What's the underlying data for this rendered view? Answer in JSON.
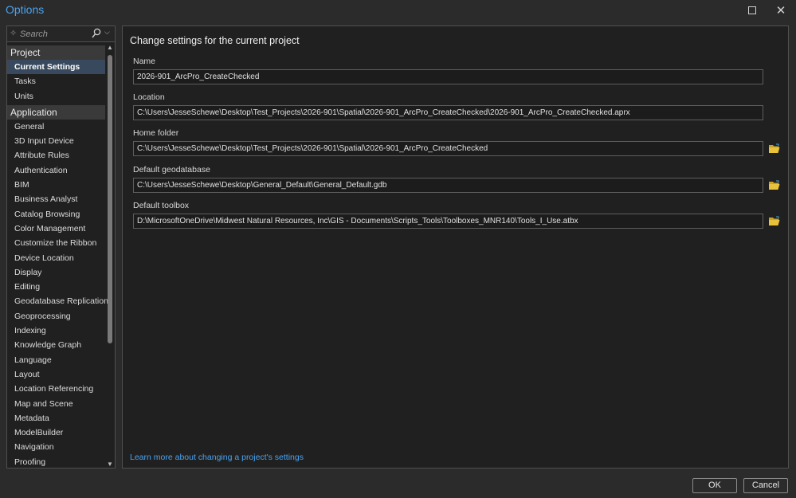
{
  "window": {
    "title": "Options"
  },
  "search": {
    "placeholder": "Search"
  },
  "nav": {
    "project_group": "Project",
    "project_items": [
      "Current Settings",
      "Tasks",
      "Units"
    ],
    "application_group": "Application",
    "application_items": [
      "General",
      "3D Input Device",
      "Attribute Rules",
      "Authentication",
      "BIM",
      "Business Analyst",
      "Catalog Browsing",
      "Color Management",
      "Customize the Ribbon",
      "Device Location",
      "Display",
      "Editing",
      "Geodatabase Replication",
      "Geoprocessing",
      "Indexing",
      "Knowledge Graph",
      "Language",
      "Layout",
      "Location Referencing",
      "Map and Scene",
      "Metadata",
      "ModelBuilder",
      "Navigation",
      "Proofing"
    ],
    "selected": "Current Settings"
  },
  "main": {
    "heading": "Change settings for the current project",
    "fields": [
      {
        "label": "Name",
        "value": "2026-901_ArcPro_CreateChecked",
        "browse": false
      },
      {
        "label": "Location",
        "value": "C:\\Users\\JesseSchewe\\Desktop\\Test_Projects\\2026-901\\Spatial\\2026-901_ArcPro_CreateChecked\\2026-901_ArcPro_CreateChecked.aprx",
        "browse": false
      },
      {
        "label": "Home folder",
        "value": "C:\\Users\\JesseSchewe\\Desktop\\Test_Projects\\2026-901\\Spatial\\2026-901_ArcPro_CreateChecked",
        "browse": true
      },
      {
        "label": "Default geodatabase",
        "value": "C:\\Users\\JesseSchewe\\Desktop\\General_Default\\General_Default.gdb",
        "browse": true
      },
      {
        "label": "Default toolbox",
        "value": "D:\\MicrosoftOneDrive\\Midwest Natural Resources, Inc\\GIS - Documents\\Scripts_Tools\\Toolboxes_MNR140\\Tools_I_Use.atbx",
        "browse": true
      }
    ],
    "learn_link": "Learn more about changing a project's settings"
  },
  "buttons": {
    "ok": "OK",
    "cancel": "Cancel"
  },
  "colors": {
    "accent": "#4aa3f0",
    "selection": "#38495e",
    "folder": "#e8c23a"
  }
}
